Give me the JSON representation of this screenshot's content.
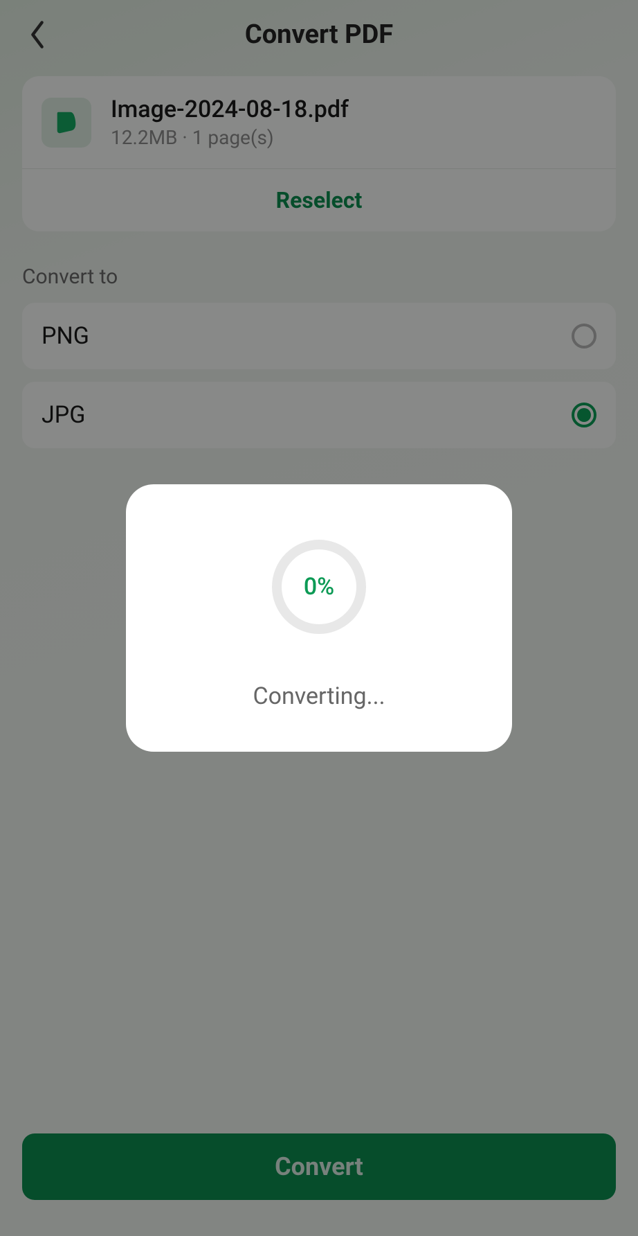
{
  "header": {
    "title": "Convert PDF"
  },
  "file": {
    "name": "Image-2024-08-18.pdf",
    "subtitle": "12.2MB · 1 page(s)",
    "reselect_label": "Reselect"
  },
  "section": {
    "convert_to_label": "Convert to"
  },
  "options": [
    {
      "label": "PNG",
      "selected": false
    },
    {
      "label": "JPG",
      "selected": true
    }
  ],
  "actions": {
    "convert_label": "Convert"
  },
  "modal": {
    "progress_percent": "0%",
    "status_text": "Converting..."
  },
  "colors": {
    "accent": "#0c9a55",
    "accent_dark": "#0c8a4e"
  }
}
